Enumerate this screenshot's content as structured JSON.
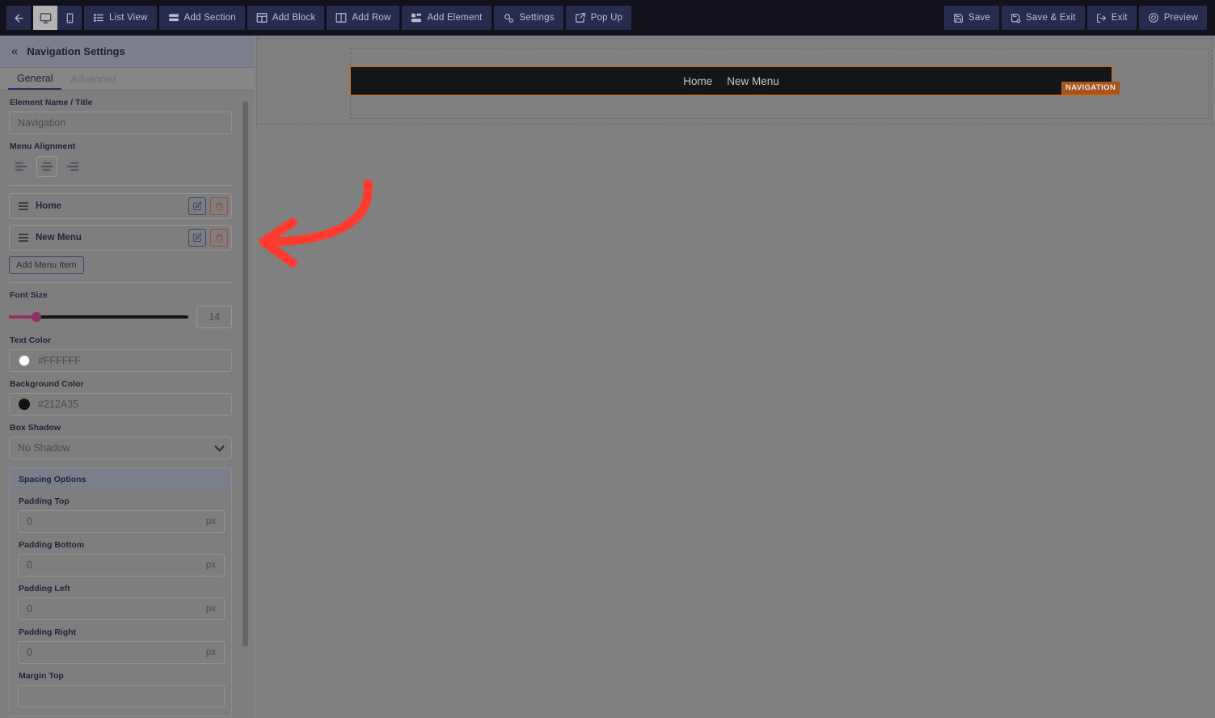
{
  "toolbar": {
    "back_label": "",
    "back_icon": "arrow-left-icon",
    "devices": [
      {
        "name": "desktop",
        "icon": "monitor-icon",
        "active": true
      },
      {
        "name": "mobile",
        "icon": "phone-icon",
        "active": false
      }
    ],
    "buttons": [
      {
        "label": "List View",
        "icon": "list-view-icon"
      },
      {
        "label": "Add Section",
        "icon": "add-section-icon"
      },
      {
        "label": "Add Block",
        "icon": "add-block-icon"
      },
      {
        "label": "Add Row",
        "icon": "add-row-icon"
      },
      {
        "label": "Add Element",
        "icon": "add-element-icon"
      },
      {
        "label": "Settings",
        "icon": "gear-icon"
      },
      {
        "label": "Pop Up",
        "icon": "popup-icon"
      }
    ],
    "right_buttons": [
      {
        "label": "Save",
        "icon": "save-icon"
      },
      {
        "label": "Save & Exit",
        "icon": "save-exit-icon"
      },
      {
        "label": "Exit",
        "icon": "exit-icon"
      },
      {
        "label": "Preview",
        "icon": "eye-icon"
      }
    ],
    "colors": {
      "bar_bg": "#11121c",
      "button_bg": "#272c4d",
      "text": "#b9bed2"
    }
  },
  "sidebar": {
    "header": {
      "title": "Navigation Settings",
      "collapse_icon": "chevron-double-left-icon"
    },
    "tabs": [
      {
        "label": "General",
        "active": true
      },
      {
        "label": "Advanced",
        "active": false
      }
    ],
    "fields": {
      "element_name_label": "Element Name / Title",
      "element_name_value": "Navigation",
      "menu_alignment_label": "Menu Alignment",
      "alignments": [
        {
          "name": "align-left",
          "active": false
        },
        {
          "name": "align-center",
          "active": true
        },
        {
          "name": "align-right",
          "active": false
        }
      ],
      "menu_items": [
        {
          "label": "Home"
        },
        {
          "label": "New Menu"
        }
      ],
      "add_menu_item_label": "Add Menu Item",
      "font_size_label": "Font Size",
      "font_size_value": "14",
      "text_color_label": "Text Color",
      "text_color_value": "#FFFFFF",
      "background_color_label": "Background Color",
      "background_color_value": "#212A35",
      "box_shadow_label": "Box Shadow",
      "box_shadow_value": "No Shadow",
      "spacing_section_label": "Spacing Options",
      "spacing": [
        {
          "label": "Padding Top",
          "value": "0",
          "unit": "px"
        },
        {
          "label": "Padding Bottom",
          "value": "0",
          "unit": "px"
        },
        {
          "label": "Padding Left",
          "value": "0",
          "unit": "px"
        },
        {
          "label": "Padding Right",
          "value": "0",
          "unit": "px"
        }
      ],
      "margin_top_label": "Margin Top"
    }
  },
  "canvas": {
    "nav_links": [
      "Home",
      "New Menu"
    ],
    "element_badge": "NAVIGATION",
    "colors": {
      "canvas_bg": "#808080",
      "nav_bg": "#141519",
      "nav_border": "#b4713a",
      "badge_bg": "#a5561f",
      "nav_text": "#c6c6c6"
    }
  },
  "annotation": {
    "arrow_color": "#ff3b30",
    "highlight_color": "#ff3b30",
    "target": "edit-menu-item-button-new-menu"
  }
}
